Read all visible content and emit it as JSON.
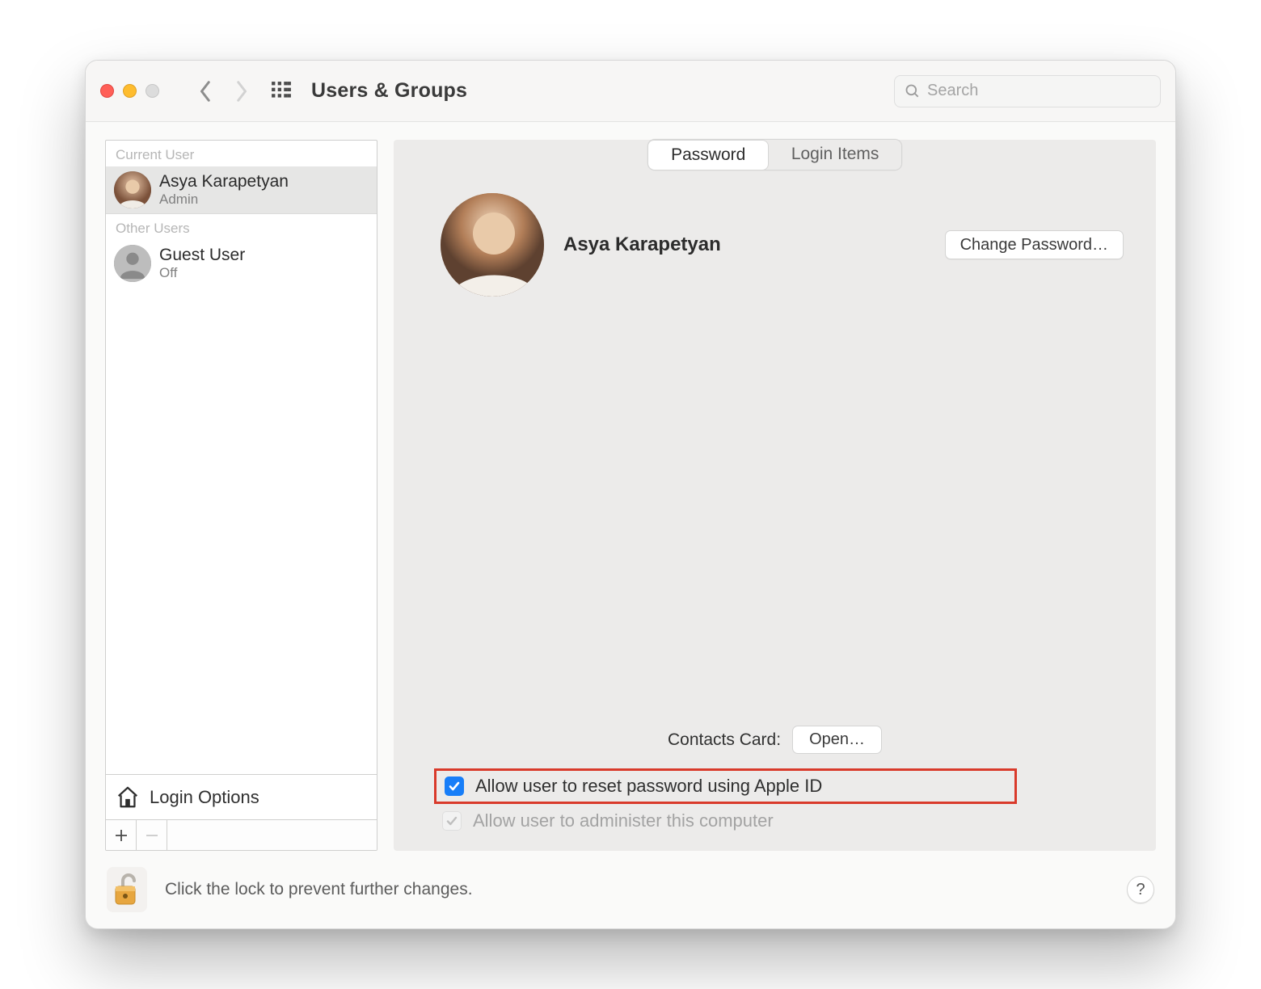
{
  "window": {
    "title": "Users & Groups",
    "search_placeholder": "Search"
  },
  "sidebar": {
    "current_user_label": "Current User",
    "other_users_label": "Other Users",
    "current_user": {
      "name": "Asya Karapetyan",
      "role": "Admin"
    },
    "other_users": [
      {
        "name": "Guest User",
        "status": "Off"
      }
    ],
    "login_options_label": "Login Options"
  },
  "tabs": {
    "password": "Password",
    "login_items": "Login Items",
    "active": "password"
  },
  "main": {
    "user_name": "Asya Karapetyan",
    "change_password_label": "Change Password…",
    "contacts_card_label": "Contacts Card:",
    "open_label": "Open…",
    "allow_reset_apple_id": {
      "label": "Allow user to reset password using Apple ID",
      "checked": true,
      "highlighted": true
    },
    "allow_administer": {
      "label": "Allow user to administer this computer",
      "checked": true,
      "enabled": false
    }
  },
  "footer": {
    "lock_text": "Click the lock to prevent further changes.",
    "help_symbol": "?"
  }
}
